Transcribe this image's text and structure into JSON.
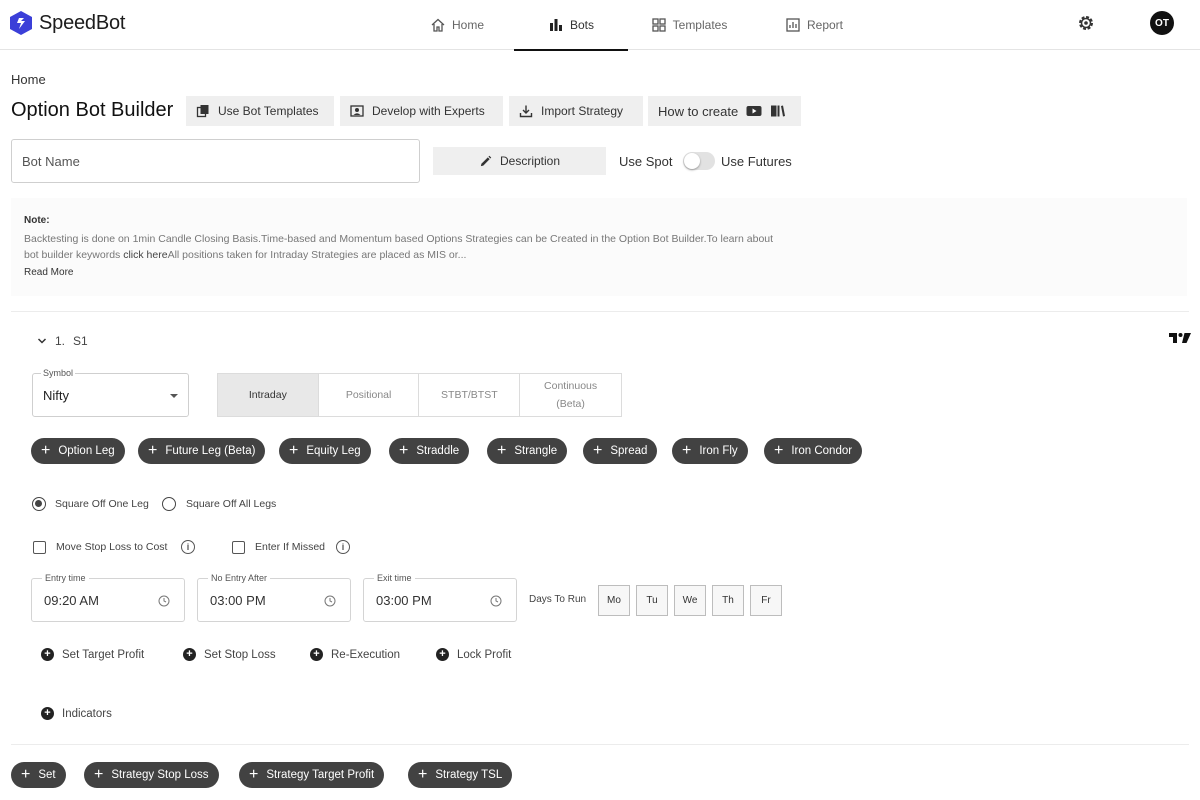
{
  "app": {
    "name": "SpeedBot"
  },
  "nav": {
    "home": "Home",
    "bots": "Bots",
    "templates": "Templates",
    "report": "Report"
  },
  "user": {
    "initials": "OT"
  },
  "breadcrumb": "Home",
  "page_title": "Option Bot Builder",
  "toolbar": {
    "use_templates": "Use Bot Templates",
    "develop_experts": "Develop with Experts",
    "import_strategy": "Import Strategy",
    "how_to_create": "How to create"
  },
  "form": {
    "bot_name_placeholder": "Bot Name",
    "description_button": "Description",
    "use_spot": "Use Spot",
    "use_futures": "Use Futures",
    "use_futures_on": false
  },
  "note": {
    "title": "Note:",
    "text_before_link": "Backtesting is done on 1min Candle Closing Basis.Time-based and Momentum based Options Strategies can be Created in the Option Bot Builder.To learn about bot builder keywords ",
    "link": "click here",
    "text_after_link": "All positions taken for Intraday Strategies are placed as MIS or...",
    "read_more": "Read More"
  },
  "strategy": {
    "index": "1.",
    "name": "S1",
    "symbol_label": "Symbol",
    "symbol_value": "Nifty",
    "modes": [
      "Intraday",
      "Positional",
      "STBT/BTST",
      "Continuous (Beta)"
    ],
    "active_mode": "Intraday",
    "legs": [
      "Option Leg",
      "Future Leg (Beta)",
      "Equity Leg",
      "Straddle",
      "Strangle",
      "Spread",
      "Iron Fly",
      "Iron Condor"
    ],
    "square_off": [
      "Square Off One Leg",
      "Square Off All Legs"
    ],
    "square_off_selected": "Square Off One Leg",
    "move_sl_to_cost": "Move Stop Loss to Cost",
    "enter_if_missed": "Enter If Missed",
    "entry_time_label": "Entry time",
    "entry_time": "09:20 AM",
    "no_entry_after_label": "No Entry After",
    "no_entry_after": "03:00 PM",
    "exit_time_label": "Exit time",
    "exit_time": "03:00 PM",
    "days_label": "Days To Run",
    "days": [
      "Mo",
      "Tu",
      "We",
      "Th",
      "Fr"
    ],
    "actions": [
      "Set Target Profit",
      "Set Stop Loss",
      "Re-Execution",
      "Lock Profit"
    ],
    "indicators": "Indicators"
  },
  "bottom_actions": [
    "Set",
    "Strategy Stop Loss",
    "Strategy Target Profit",
    "Strategy TSL"
  ]
}
